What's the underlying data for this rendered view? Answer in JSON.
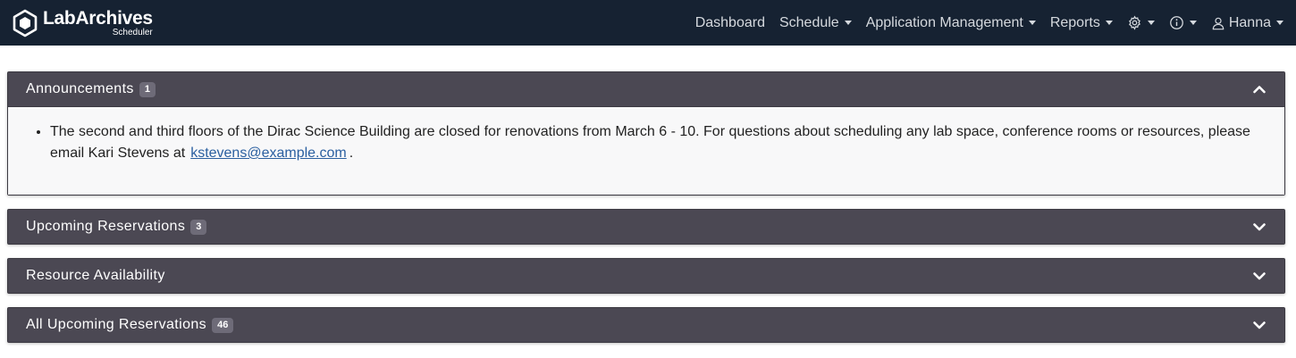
{
  "app": {
    "brand_name": "LabArchives",
    "brand_sub": "Scheduler"
  },
  "nav": {
    "dashboard": "Dashboard",
    "schedule": "Schedule",
    "app_management": "Application Management",
    "reports": "Reports",
    "settings_icon": "gear-icon",
    "info_icon": "info-icon",
    "user_icon": "user-icon",
    "user": "Hanna"
  },
  "panels": [
    {
      "title": "Announcements",
      "badge": "1",
      "expanded": true,
      "announcement": {
        "text": "The second and third floors of the Dirac Science Building are closed for renovations from March 6 - 10. For questions about scheduling any lab space, conference rooms or resources, please email Kari Stevens at",
        "email": "kstevens@example.com",
        "trailing": "."
      }
    },
    {
      "title": "Upcoming Reservations",
      "badge": "3",
      "expanded": false
    },
    {
      "title": "Resource Availability",
      "badge": "",
      "expanded": false
    },
    {
      "title": "All Upcoming Reservations",
      "badge": "46",
      "expanded": false
    }
  ],
  "colors": {
    "navbar": "#162232",
    "panel_header": "#4b4853",
    "badge": "#6e6b78",
    "link": "#2a5fa0"
  }
}
